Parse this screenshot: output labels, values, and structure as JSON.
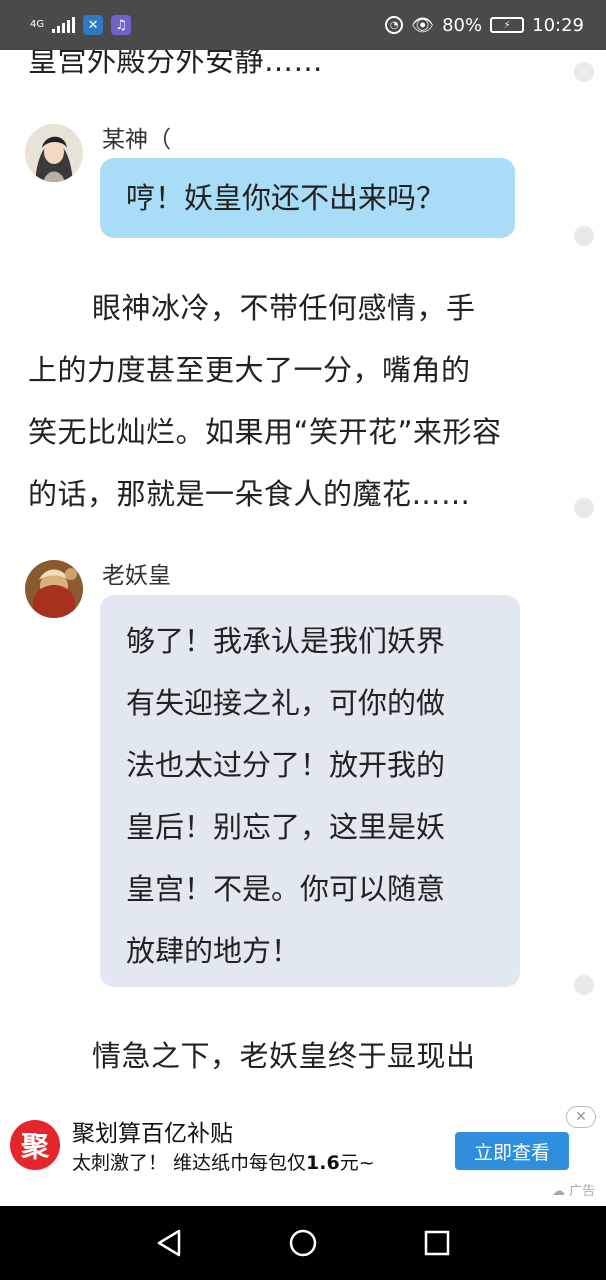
{
  "status_bar": {
    "network": "4G",
    "network_sub": "4G",
    "app_icons": [
      "messenger-icon",
      "music-icon"
    ],
    "battery_percent": "80%",
    "time": "10:29"
  },
  "content": {
    "top_text": "皇宫外殿分外安静……",
    "msg1": {
      "name": "某神（",
      "text": "哼！妖皇你还不出来吗？"
    },
    "narration1": [
      "眼神冰冷，不带任何感情，手",
      "上的力度甚至更大了一分，嘴角的",
      "笑无比灿烂。如果用“笑开花”来形容",
      "的话，那就是一朵食人的魔花……"
    ],
    "msg2": {
      "name": "老妖皇",
      "lines": [
        "够了！我承认是我们妖界",
        "有失迎接之礼，可你的做",
        "法也太过分了！放开我的",
        "皇后！别忘了，这里是妖",
        "皇宫！不是。你可以随意",
        "放肆的地方！"
      ]
    },
    "narration2": "情急之下，老妖皇终于显现出"
  },
  "ad": {
    "logo_char": "聚",
    "title": "聚划算百亿补贴",
    "subtitle_pre": "太刺激了！ 维达纸巾每包仅",
    "subtitle_price": "1.6",
    "subtitle_post": "元~",
    "button": "立即查看",
    "close": "✕",
    "tag": "广告"
  },
  "nav": [
    "back-icon",
    "home-icon",
    "recents-icon"
  ]
}
